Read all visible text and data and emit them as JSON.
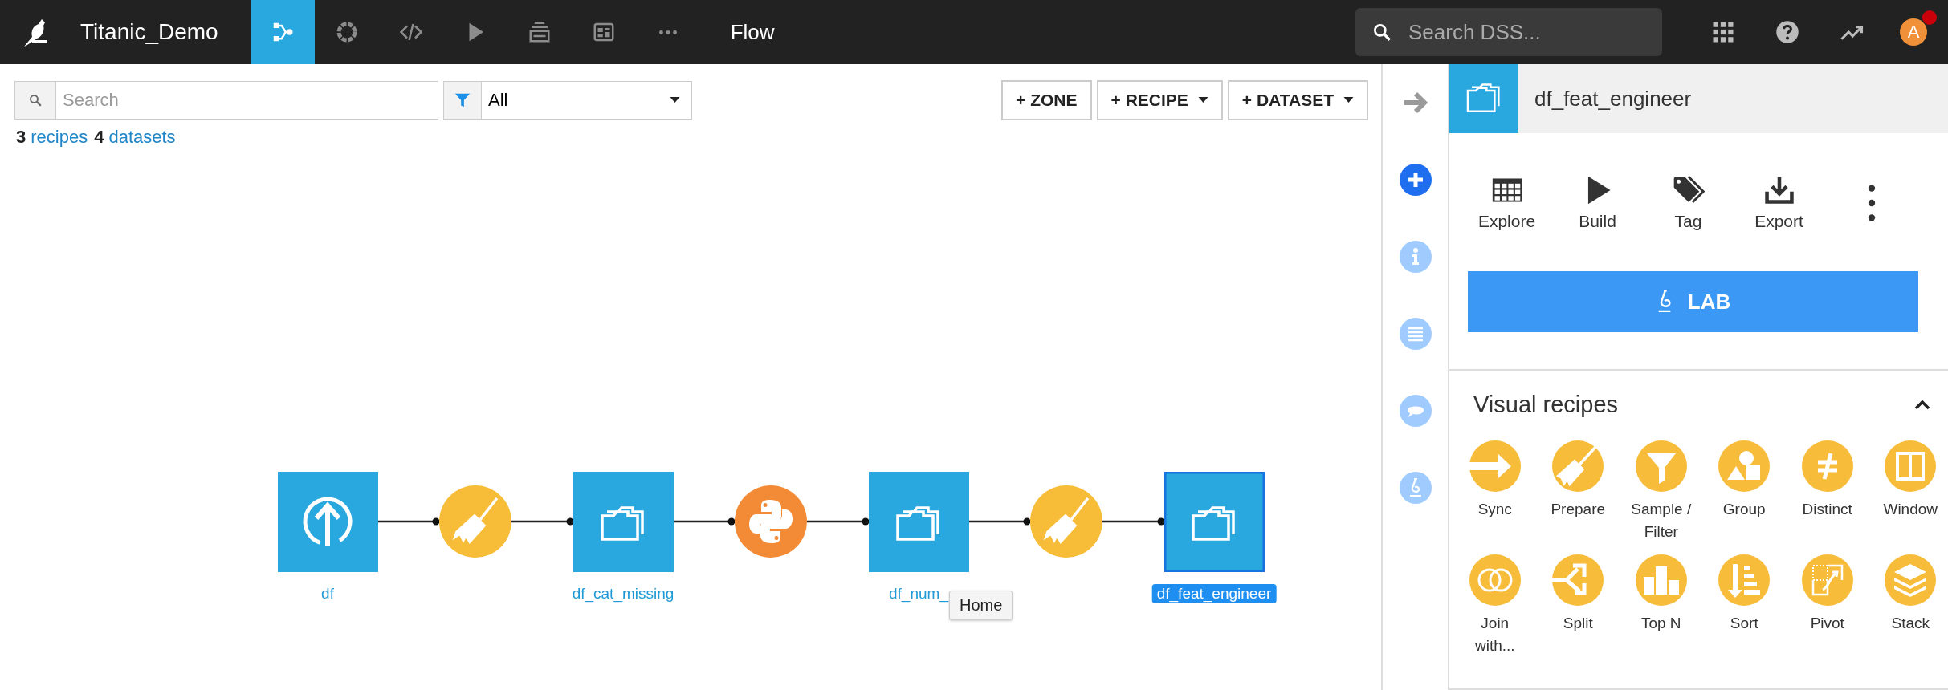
{
  "topbar": {
    "project": "Titanic_Demo",
    "nav": [
      {
        "kind": "flow",
        "selected": true
      },
      {
        "kind": "ring",
        "selected": false
      },
      {
        "kind": "code",
        "selected": false
      },
      {
        "kind": "play",
        "selected": false
      },
      {
        "kind": "stack",
        "selected": false
      },
      {
        "kind": "dashboard",
        "selected": false
      },
      {
        "kind": "more",
        "selected": false
      }
    ],
    "page": "Flow",
    "search": {
      "placeholder": "Search DSS..."
    },
    "avatar": "A",
    "notification": true
  },
  "toolbar": {
    "search": {
      "placeholder": "Search"
    },
    "filter": "All",
    "buttons": [
      {
        "label": "+ ZONE",
        "dropdown": false
      },
      {
        "label": "+ RECIPE",
        "dropdown": true
      },
      {
        "label": "+ DATASET",
        "dropdown": true
      }
    ]
  },
  "summary": [
    {
      "count": "3",
      "label": "recipes"
    },
    {
      "count": "4",
      "label": "datasets"
    }
  ],
  "flow": {
    "nodes": [
      {
        "kind": "upload_dataset",
        "label": "df",
        "selected": false
      },
      {
        "kind": "prepare_recipe"
      },
      {
        "kind": "dataset",
        "label": "df_cat_missing",
        "selected": false
      },
      {
        "kind": "python_recipe"
      },
      {
        "kind": "dataset",
        "label": "df_num_",
        "selected": false
      },
      {
        "kind": "prepare_recipe"
      },
      {
        "kind": "dataset",
        "label": "df_feat_engineer",
        "selected": true
      }
    ],
    "tooltip": "Home"
  },
  "rail": [
    {
      "kind": "arrow",
      "selected": false
    },
    {
      "kind": "plus",
      "selected": true
    },
    {
      "kind": "info",
      "selected": false
    },
    {
      "kind": "list",
      "selected": false
    },
    {
      "kind": "comment",
      "selected": false
    },
    {
      "kind": "lab",
      "selected": false
    }
  ],
  "panel": {
    "title": "df_feat_engineer",
    "actions": [
      {
        "kind": "explore",
        "label": "Explore"
      },
      {
        "kind": "build",
        "label": "Build"
      },
      {
        "kind": "tag",
        "label": "Tag"
      },
      {
        "kind": "export",
        "label": "Export"
      }
    ],
    "lab": "LAB",
    "visual_recipes": {
      "title": "Visual recipes",
      "expanded": true,
      "items": [
        {
          "kind": "sync",
          "label": "Sync"
        },
        {
          "kind": "prepare",
          "label": "Prepare"
        },
        {
          "kind": "filter",
          "label": "Sample / Filter"
        },
        {
          "kind": "group",
          "label": "Group"
        },
        {
          "kind": "distinct",
          "label": "Distinct"
        },
        {
          "kind": "window",
          "label": "Window"
        },
        {
          "kind": "join",
          "label": "Join with..."
        },
        {
          "kind": "split",
          "label": "Split"
        },
        {
          "kind": "topn",
          "label": "Top N"
        },
        {
          "kind": "sort",
          "label": "Sort"
        },
        {
          "kind": "pivot",
          "label": "Pivot"
        },
        {
          "kind": "stack",
          "label": "Stack"
        }
      ]
    }
  }
}
